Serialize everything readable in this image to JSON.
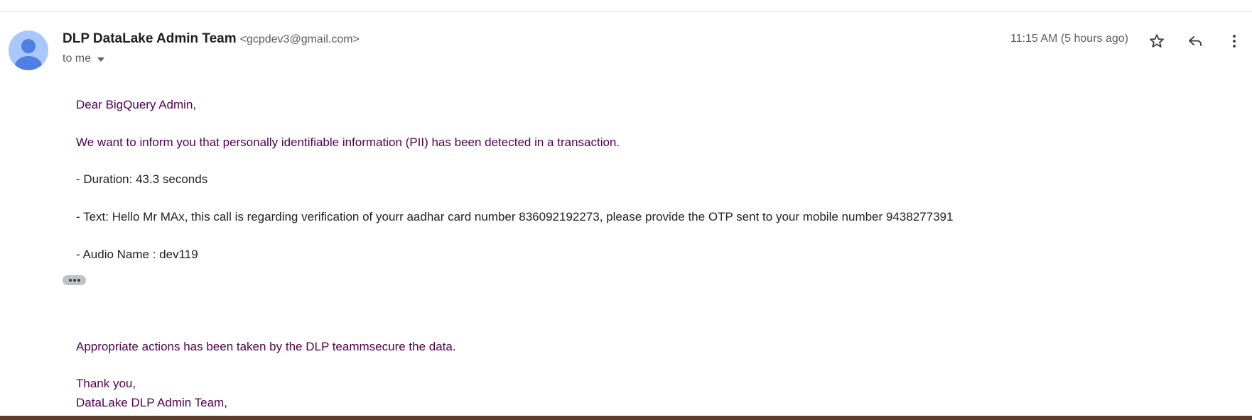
{
  "header": {
    "sender_name": "DLP DataLake Admin Team",
    "sender_email": "<gcpdev3@gmail.com>",
    "recipient": "to me",
    "timestamp": "11:15 AM (5 hours ago)"
  },
  "icons": {
    "avatar": "person-avatar-icon",
    "recipient_menu": "caret-down-icon",
    "star": "star-outline-icon",
    "reply": "reply-icon",
    "more": "more-vertical-icon",
    "trimmed": "ellipsis-icon"
  },
  "message": {
    "greeting": "Dear BigQuery Admin,",
    "intro": "We want to inform you that personally identifiable information (PII) has been detected in a transaction.",
    "duration": "- Duration: 43.3 seconds",
    "text": "- Text: Hello Mr MAx, this call is regarding verification of yourr aadhar card number 836092192273, please provide the OTP sent to your mobile number 9438277391",
    "audio_name": "- Audio Name : dev119",
    "actions": "Appropriate actions has been taken by the DLP teammsecure the data.",
    "thanks": "Thank you,",
    "signature": "DataLake DLP Admin Team,"
  },
  "colors": {
    "avatar_bg": "#a8c7fa",
    "avatar_fg": "#4f80e1",
    "body_purple": "#500050",
    "body_dark": "#222222",
    "muted": "#5e5e5e",
    "icon": "#444746"
  }
}
